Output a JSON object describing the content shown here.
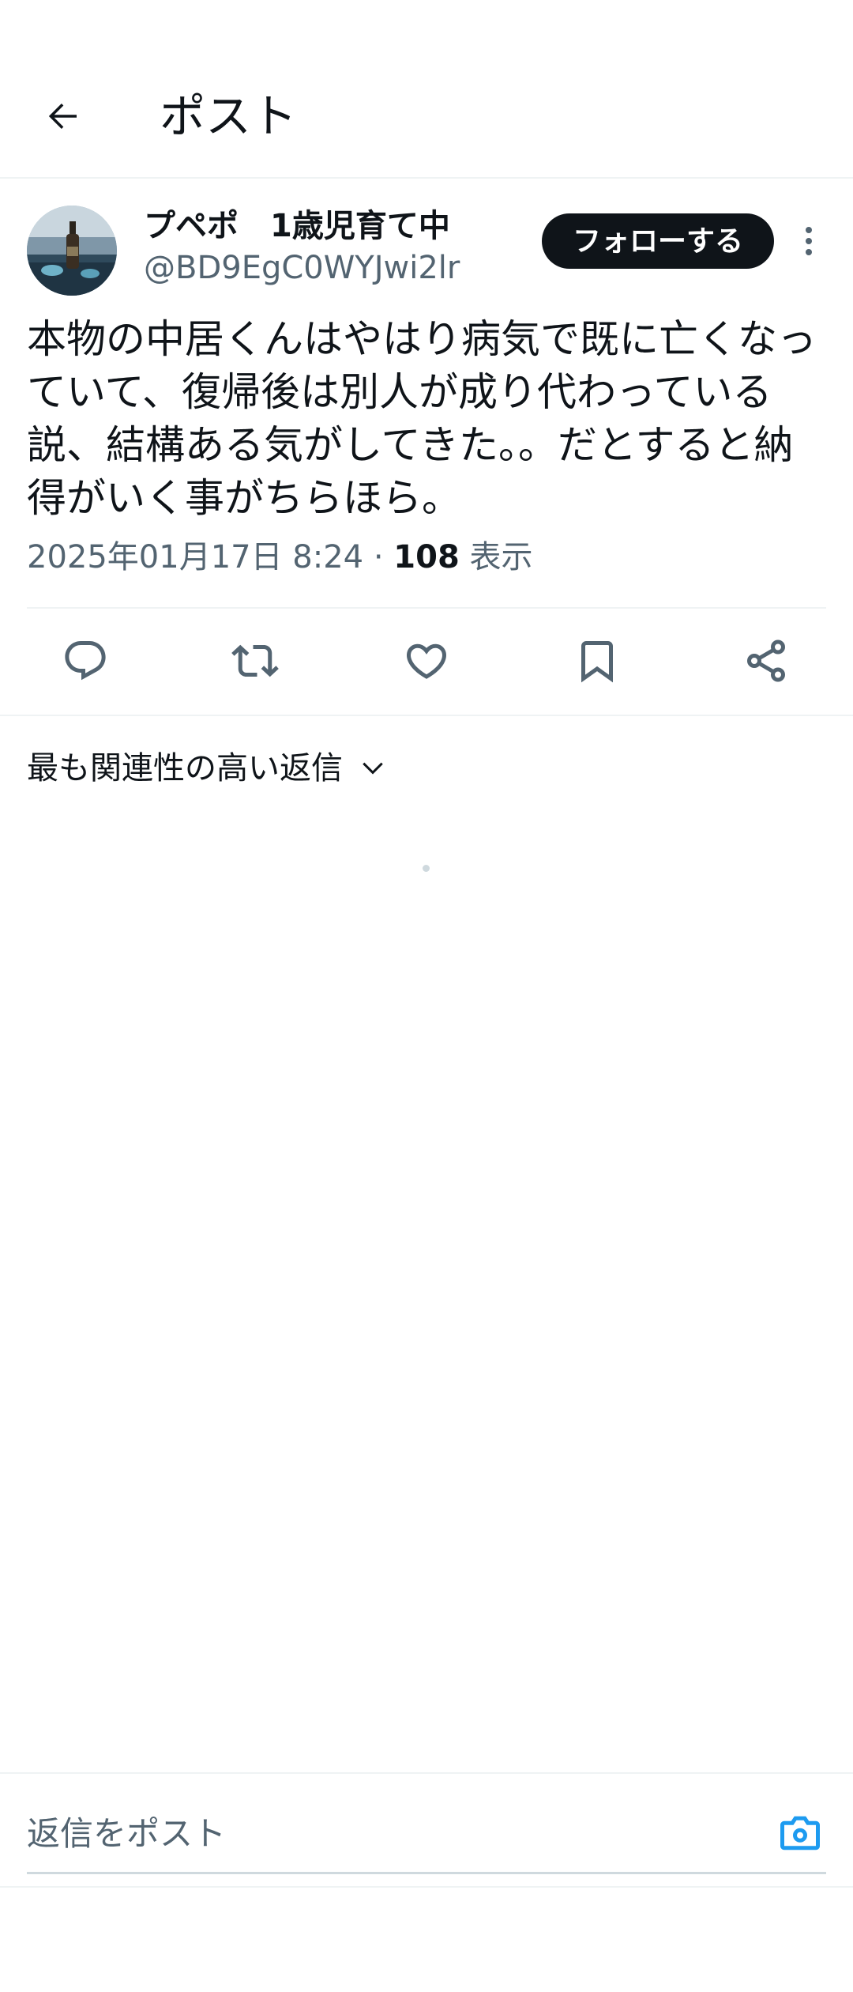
{
  "header": {
    "back_icon": "arrow-left-icon",
    "title": "ポスト"
  },
  "post": {
    "author": {
      "display_name": "プペポ　1歳児育て中",
      "handle": "@BD9EgC0WYJwi2lr",
      "avatar_icon": "profile-photo-bottle-by-sea"
    },
    "follow_label": "フォローする",
    "more_icon": "more-vertical-icon",
    "text": "本物の中居くんはやはり病気で既に亡くなっていて、復帰後は別人が成り代わっている説、結構ある気がしてきた。。だとすると納得がいく事がちらほら。",
    "timestamp": "2025年01月17日 8:24",
    "separator": " · ",
    "views_count": "108",
    "views_label": " 表示",
    "actions": [
      {
        "name": "reply",
        "icon": "reply-icon"
      },
      {
        "name": "repost",
        "icon": "repost-icon"
      },
      {
        "name": "like",
        "icon": "heart-icon"
      },
      {
        "name": "bookmark",
        "icon": "bookmark-icon"
      },
      {
        "name": "share",
        "icon": "share-icon"
      }
    ]
  },
  "replies": {
    "sort_label": "最も関連性の高い返信",
    "sort_icon": "chevron-down-icon"
  },
  "reply_bar": {
    "placeholder": "返信をポスト",
    "camera_icon": "camera-icon"
  },
  "colors": {
    "text_primary": "#0f1419",
    "text_secondary": "#536471",
    "accent": "#1d9bf0",
    "divider": "#eff3f4"
  }
}
